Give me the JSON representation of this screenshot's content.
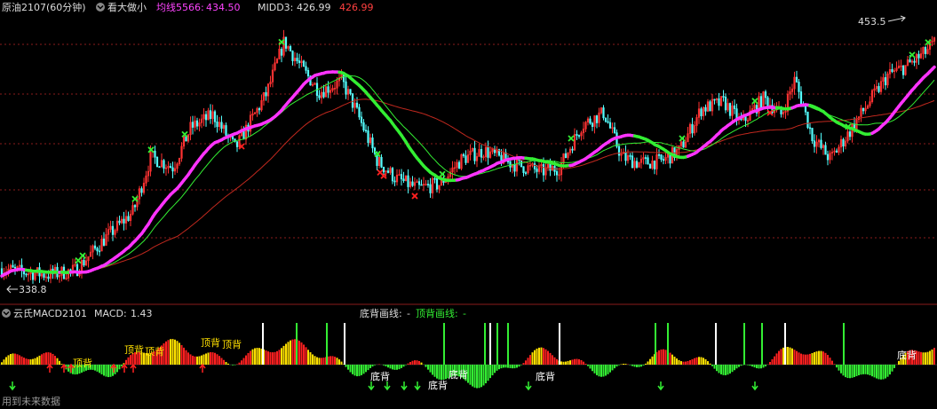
{
  "header": {
    "symbol": "原油2107(60分钟)",
    "indicator": "看大做小",
    "ma_label": "均线5566:",
    "ma_value": "434.50",
    "midd_label": "MIDD3:",
    "midd_value": "426.99",
    "midd_value2": "426.99"
  },
  "sub_header": {
    "name": "云氏MACD2101",
    "macd_label": "MACD:",
    "macd_value": "1.43",
    "bottom_div_label": "底背画线:",
    "bottom_div_value": "-",
    "top_div_label": "顶背画线:",
    "top_div_value": "-"
  },
  "footer": {
    "note": "用到未来数据"
  },
  "colors": {
    "background": "#000000",
    "candle_up": "#ff3232",
    "candle_down": "#54ffff",
    "ma_magenta": "#ff33ff",
    "ma_green": "#33ee33",
    "ma_red": "#c0281e",
    "grid": "#8a1c1c",
    "header_white": "#dcdcdc",
    "header_magenta": "#ff44ff",
    "header_red": "#ff4040",
    "macd_green": "#33ee33",
    "macd_red": "#ff2020",
    "macd_yellow": "#ffe000",
    "macd_white": "#ffffff",
    "label_yellow": "#ffe000"
  },
  "chart_data": [
    {
      "type": "candlestick",
      "title": "原油2107(60分钟)",
      "ylim": [
        330,
        465
      ],
      "annotations": [
        {
          "text": "453.5",
          "value": 453.5
        },
        {
          "text": "338.8",
          "value": 338.8
        }
      ],
      "price_path": [
        [
          0,
          345
        ],
        [
          30,
          343
        ],
        [
          55,
          342
        ],
        [
          85,
          344
        ],
        [
          120,
          360
        ],
        [
          150,
          372
        ],
        [
          170,
          398
        ],
        [
          195,
          393
        ],
        [
          215,
          412
        ],
        [
          240,
          418
        ],
        [
          265,
          402
        ],
        [
          300,
          428
        ],
        [
          320,
          453
        ],
        [
          340,
          440
        ],
        [
          360,
          429
        ],
        [
          385,
          434
        ],
        [
          400,
          421
        ],
        [
          425,
          396
        ],
        [
          445,
          388
        ],
        [
          470,
          383
        ],
        [
          495,
          385
        ],
        [
          520,
          397
        ],
        [
          545,
          401
        ],
        [
          575,
          395
        ],
        [
          610,
          391
        ],
        [
          630,
          393
        ],
        [
          655,
          413
        ],
        [
          680,
          419
        ],
        [
          700,
          398
        ],
        [
          720,
          395
        ],
        [
          745,
          396
        ],
        [
          765,
          401
        ],
        [
          790,
          421
        ],
        [
          815,
          424
        ],
        [
          835,
          414
        ],
        [
          860,
          426
        ],
        [
          880,
          418
        ],
        [
          895,
          435
        ],
        [
          915,
          407
        ],
        [
          935,
          397
        ],
        [
          955,
          409
        ],
        [
          980,
          425
        ],
        [
          1000,
          437
        ],
        [
          1020,
          441
        ],
        [
          1040,
          447
        ],
        [
          1052,
          452
        ]
      ],
      "markers_green_x": [
        88,
        93,
        152,
        170,
        208,
        317,
        425,
        498,
        643,
        768,
        850,
        955,
        1027,
        1045
      ],
      "markers_red_x": [
        272,
        428,
        432,
        467,
        867
      ]
    },
    {
      "type": "bar",
      "title": "云氏MACD2101",
      "series": [
        {
          "name": "MACD",
          "last_value": 1.43
        }
      ],
      "bar_colors": [
        "green",
        "red",
        "yellow"
      ],
      "signal_labels": [
        "顶背",
        "顶背",
        "顶背",
        "顶背",
        "顶背",
        "底背",
        "底背",
        "底背",
        "底背",
        "底背",
        "顶背"
      ]
    }
  ]
}
